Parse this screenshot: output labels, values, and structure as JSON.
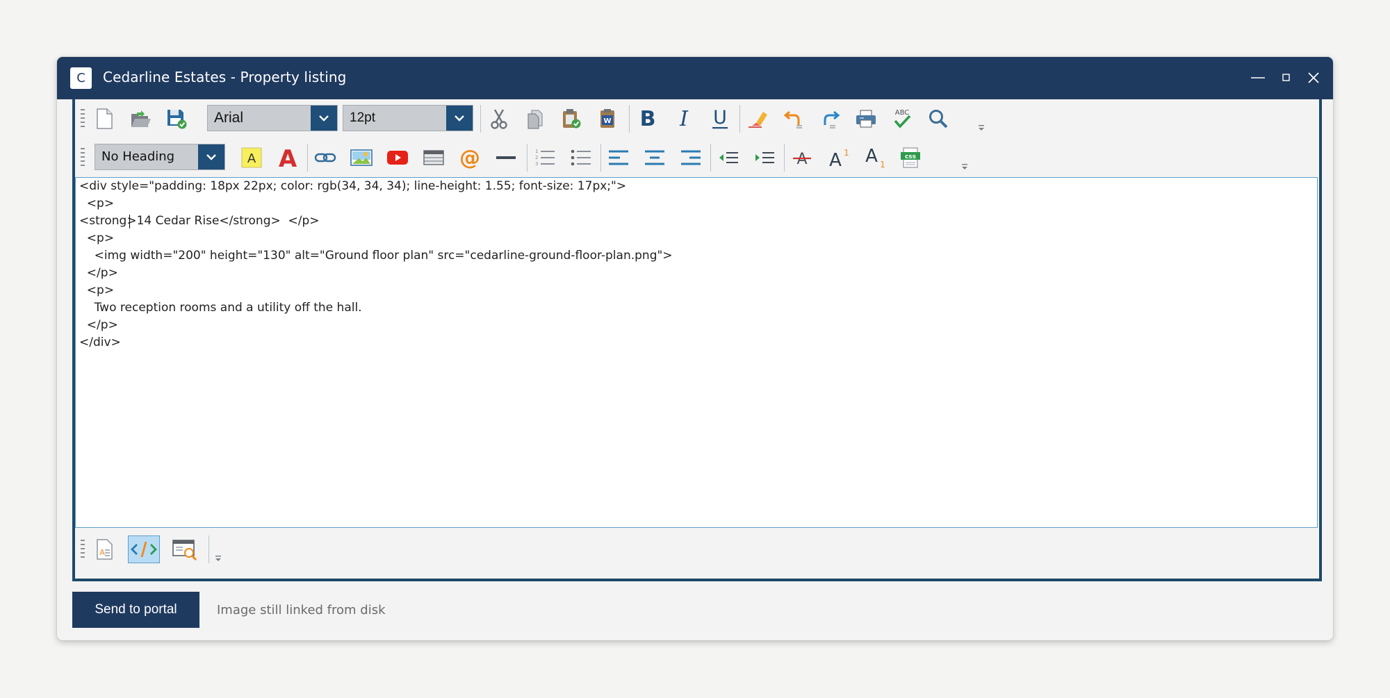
{
  "window": {
    "logo_letter": "C",
    "title": "Cedarline Estates - Property listing"
  },
  "toolbar1": {
    "font_family": "Arial",
    "font_size": "12pt",
    "icons": [
      "new-document-icon",
      "open-folder-icon",
      "save-icon",
      "cut-icon",
      "copy-icon",
      "paste-icon",
      "paste-from-word-icon",
      "bold-icon",
      "italic-icon",
      "underline-icon",
      "clear-formatting-icon",
      "undo-icon",
      "redo-icon",
      "print-icon",
      "spellcheck-icon",
      "find-icon"
    ],
    "spellcheck_label": "ABC",
    "paste_word_label": "W"
  },
  "toolbar2": {
    "heading": "No Heading",
    "highlight_letter": "A",
    "font_color_letter": "A",
    "css_label": "css",
    "icons": [
      "highlight-color-icon",
      "font-color-icon",
      "insert-link-icon",
      "insert-image-icon",
      "insert-video-icon",
      "insert-table-icon",
      "insert-email-icon",
      "horizontal-rule-icon",
      "ordered-list-icon",
      "unordered-list-icon",
      "align-left-icon",
      "align-center-icon",
      "align-right-icon",
      "outdent-icon",
      "indent-icon",
      "strikethrough-icon",
      "superscript-icon",
      "subscript-icon",
      "css-icon"
    ]
  },
  "source": {
    "lines": [
      "<div style=\"padding: 18px 22px; color: rgb(34, 34, 34); line-height: 1.55; font-size: 17px;\">",
      "  <p>",
      "<strong>14 Cedar Rise</strong>  </p>",
      "  <p>",
      "    <img width=\"200\" height=\"130\" alt=\"Ground floor plan\" src=\"cedarline-ground-floor-plan.png\">",
      "  </p>",
      "  <p>",
      "    Two reception rooms and a utility off the hall.",
      "  </p>",
      "</div>"
    ],
    "caret_line": 2
  },
  "toolbar3": {
    "modes": [
      "design-view-icon",
      "html-source-icon",
      "preview-icon"
    ],
    "active_mode": "html-source-icon"
  },
  "footer": {
    "send_label": "Send to portal",
    "status": "Image still linked from disk"
  },
  "colors": {
    "titlebar": "#1f3a5f",
    "editor_frame": "#1e4a69",
    "accent": "#2a7bb0"
  }
}
